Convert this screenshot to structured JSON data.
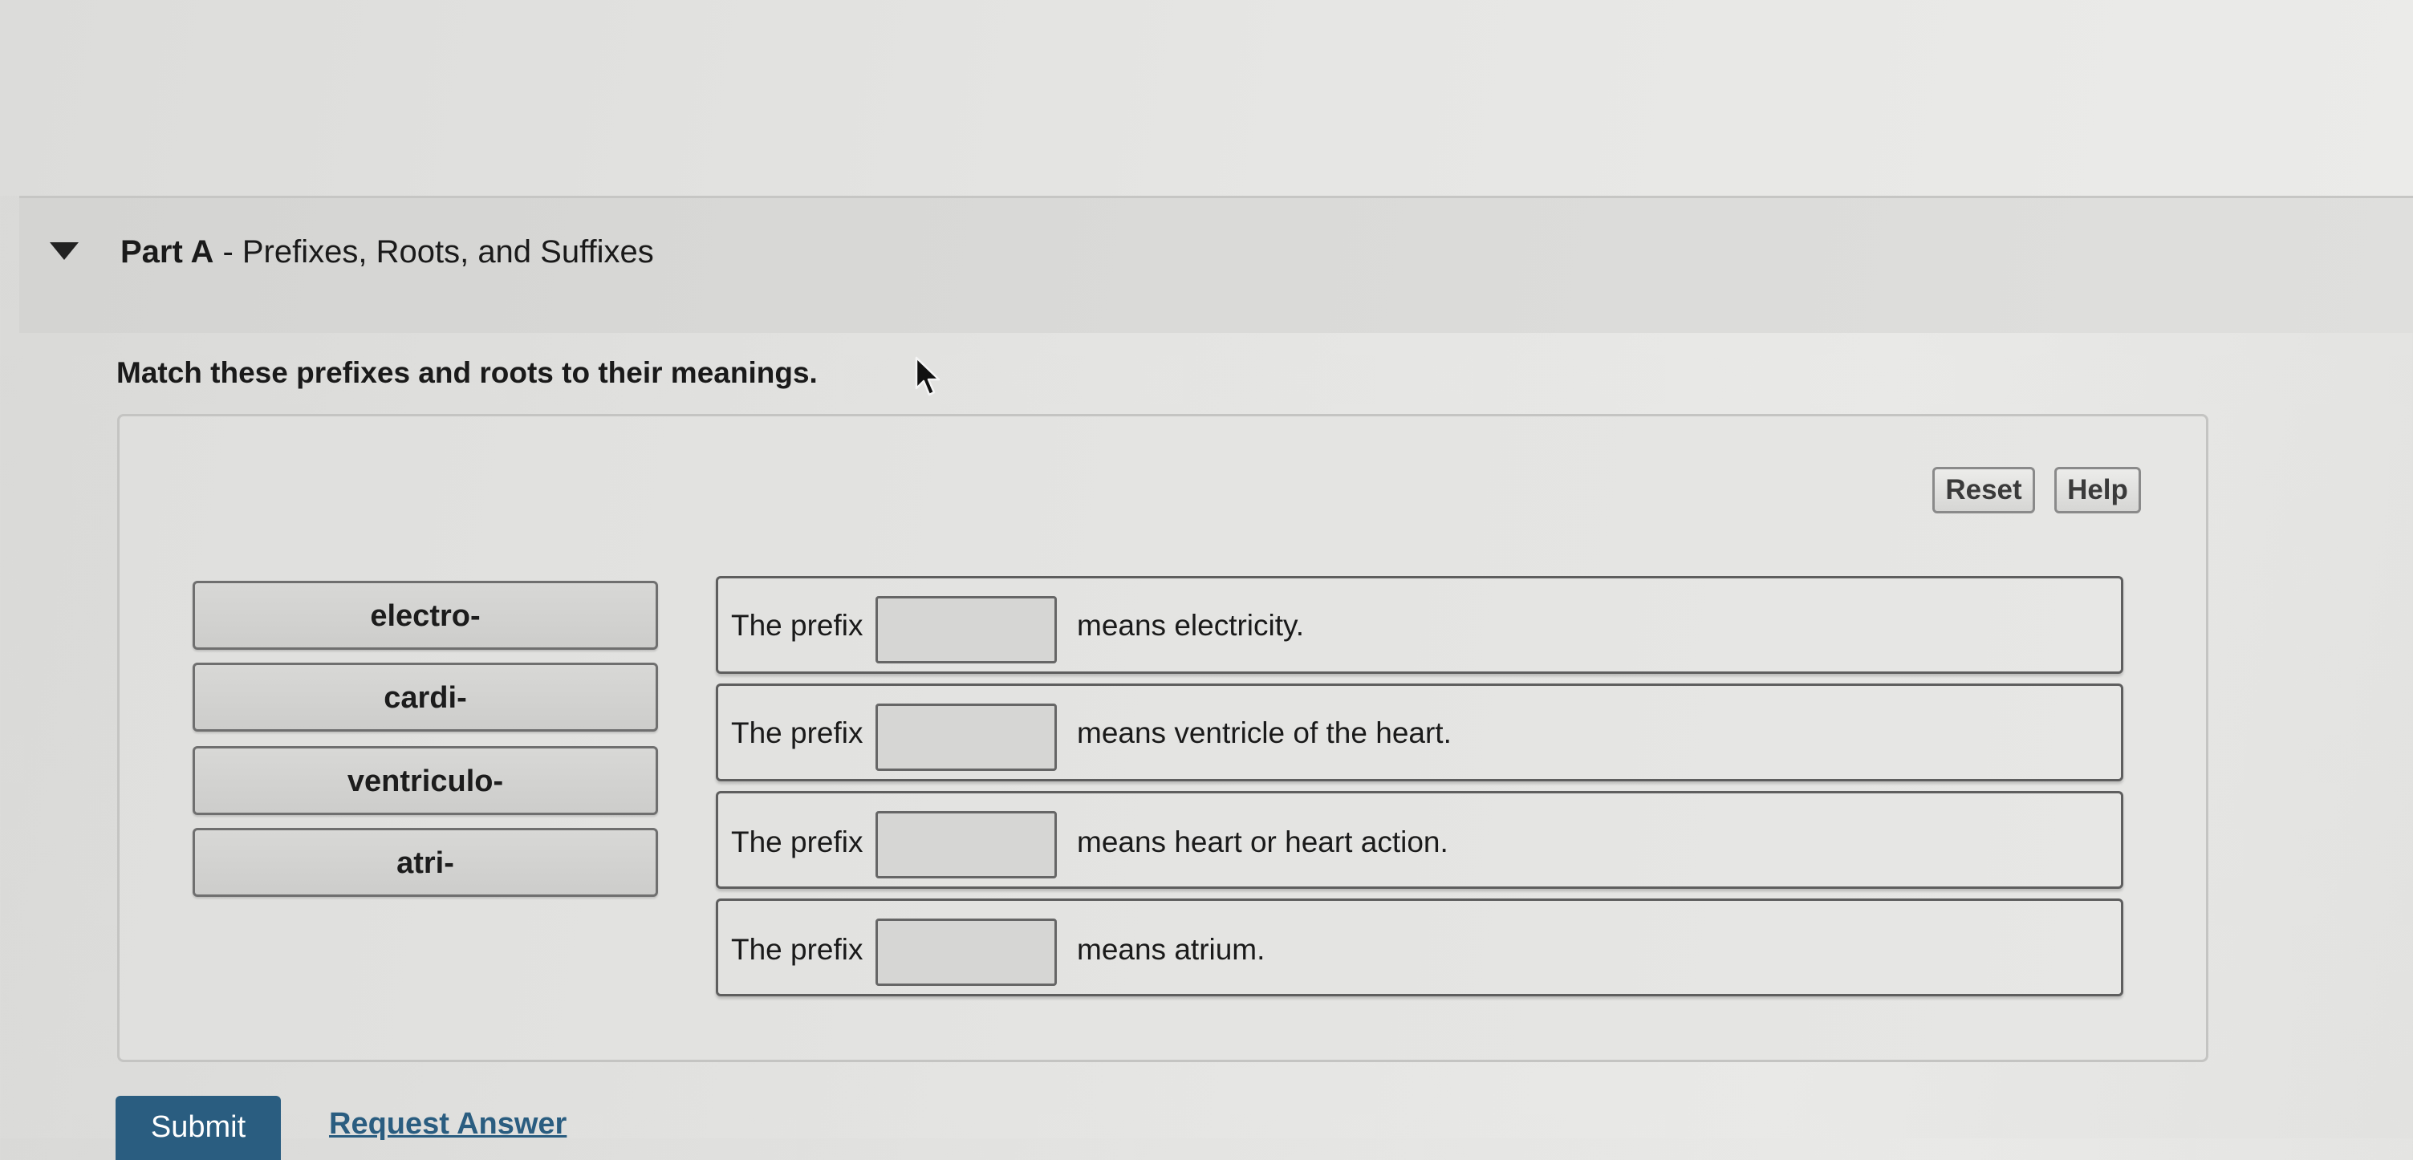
{
  "part": {
    "label": "Part A",
    "separator": " - ",
    "title": "Prefixes, Roots, and Suffixes"
  },
  "instructions": "Match these prefixes and roots to their meanings.",
  "toolbar": {
    "reset_label": "Reset",
    "help_label": "Help"
  },
  "chips": [
    {
      "label": "electro-"
    },
    {
      "label": "cardi-"
    },
    {
      "label": "ventriculo-"
    },
    {
      "label": "atri-"
    }
  ],
  "rows": [
    {
      "prefix_text": "The prefix",
      "meaning": "means electricity."
    },
    {
      "prefix_text": "The prefix",
      "meaning": "means ventricle of the heart."
    },
    {
      "prefix_text": "The prefix",
      "meaning": "means heart or heart action."
    },
    {
      "prefix_text": "The prefix",
      "meaning": "means atrium."
    }
  ],
  "actions": {
    "submit_label": "Submit",
    "request_answer_label": "Request Answer"
  },
  "icons": {
    "collapse": "caret-down-icon",
    "cursor": "mouse-pointer-icon"
  },
  "colors": {
    "accent": "#2a5d80"
  }
}
